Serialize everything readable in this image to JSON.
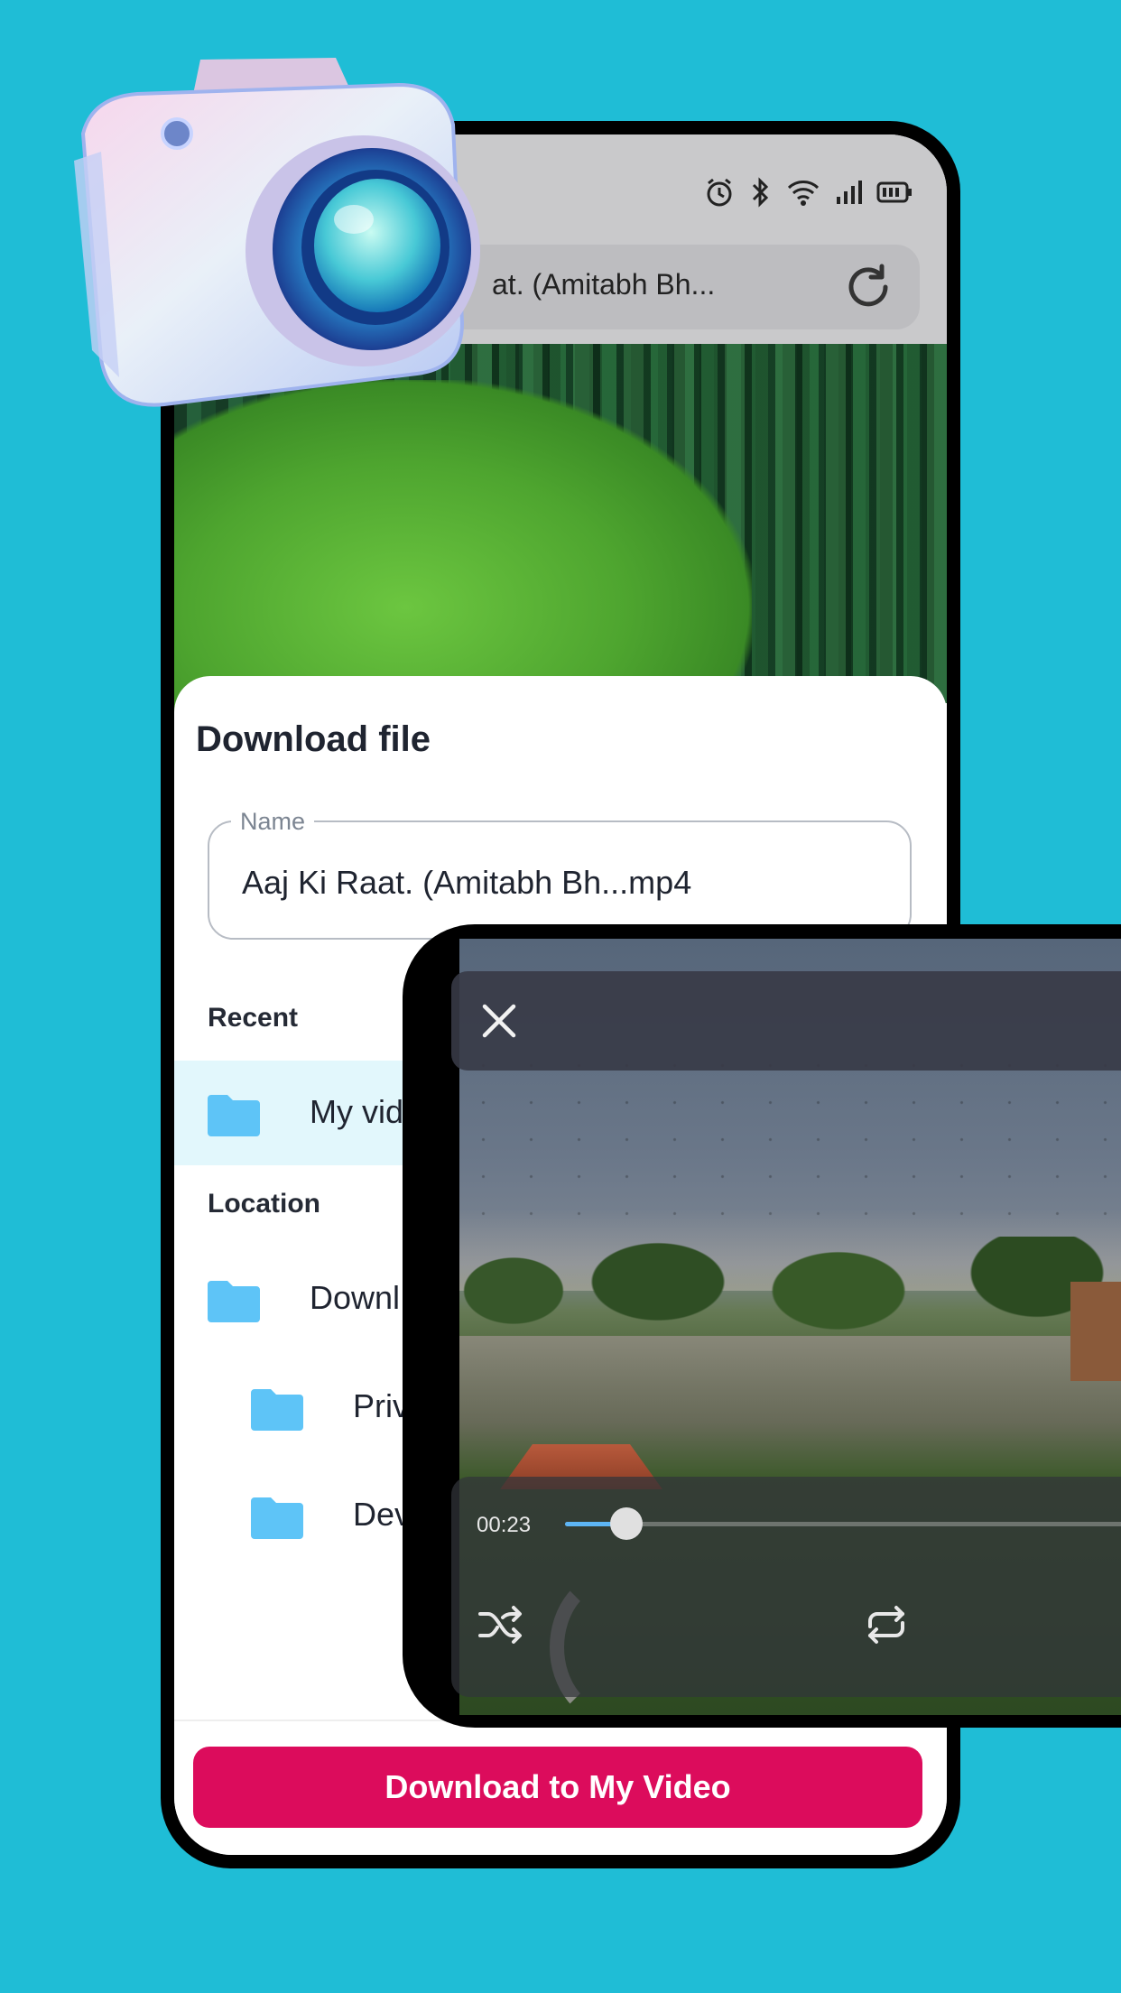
{
  "browser": {
    "url_text": "at. (Amitabh Bh..."
  },
  "download_sheet": {
    "title": "Download file",
    "name_label": "Name",
    "name_value": "Aaj Ki Raat. (Amitabh Bh...mp4",
    "recent_label": "Recent",
    "recent_items": [
      {
        "label": "My vid",
        "icon": "folder-icon",
        "selected": true
      }
    ],
    "location_label": "Location",
    "location_items": [
      {
        "label": "Downl",
        "icon": "folder-icon",
        "level": 0
      },
      {
        "label": "Priv",
        "icon": "folder-icon",
        "level": 1
      },
      {
        "label": "Dev",
        "icon": "folder-icon",
        "level": 1
      }
    ],
    "download_button": "Download to My Video"
  },
  "player": {
    "current_time": "00:23",
    "progress": 0.105
  },
  "colors": {
    "background": "#1fbdd6",
    "accent_button": "#dc0c5c",
    "folder": "#5ec4f7",
    "selected_row": "#e2f7fc",
    "progress_fill": "#5db5f5"
  }
}
